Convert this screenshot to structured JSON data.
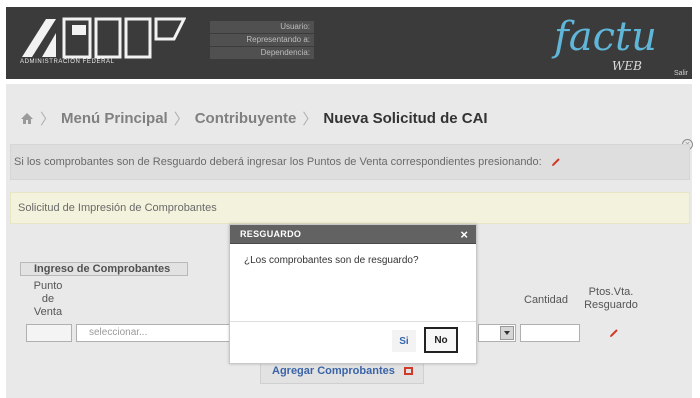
{
  "header": {
    "logo_text": "ADMINISTRACION FEDERAL",
    "user_label": "Usuario:",
    "representando_label": "Representando a:",
    "dependencia_label": "Dependencia:",
    "brand": "factu",
    "brand_sub": "WEB",
    "logout": "Salir"
  },
  "breadcrumb": {
    "items": [
      "Menú Principal",
      "Contribuyente"
    ],
    "current": "Nueva Solicitud de CAI"
  },
  "info": {
    "text": "Si los comprobantes son de Resguardo deberá ingresar los Puntos de Venta correspondientes presionando:"
  },
  "solicitud": {
    "title": "Solicitud de Impresión de Comprobantes"
  },
  "ingreso": {
    "title": "Ingreso de Comprobantes",
    "col_punto": "Punto de Venta",
    "col_cantidad": "Cantidad",
    "col_ptos": "Ptos.Vta. Resguardo",
    "select_placeholder": "seleccionar...",
    "add_button": "Agregar Comprobantes"
  },
  "modal": {
    "title": "RESGUARDO",
    "message": "¿Los comprobantes son de resguardo?",
    "yes": "Si",
    "no": "No"
  },
  "colors": {
    "header_bg": "#3b3b3b",
    "brand": "#5fb6d8",
    "edit_icon": "#d03a2a",
    "modal_header": "#626262"
  }
}
